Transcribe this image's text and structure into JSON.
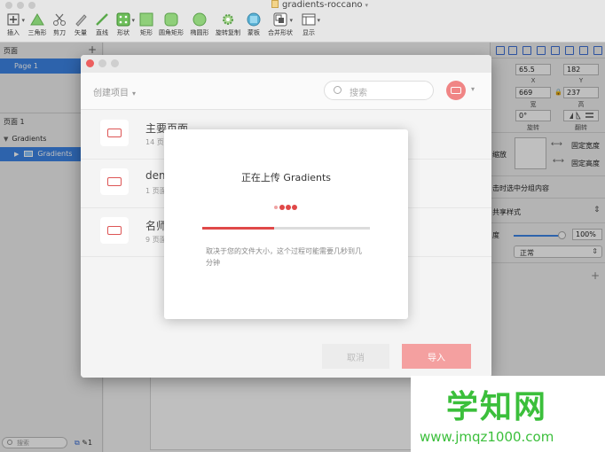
{
  "window": {
    "title": "gradients-roccano"
  },
  "toolbar": {
    "items": [
      {
        "label": "插入"
      },
      {
        "label": "三角形"
      },
      {
        "label": "剪刀"
      },
      {
        "label": "矢量"
      },
      {
        "label": "直线"
      },
      {
        "label": "形状"
      },
      {
        "label": "矩形"
      },
      {
        "label": "圆角矩形"
      },
      {
        "label": "椭圆形"
      },
      {
        "label": "旋转复制"
      },
      {
        "label": "蒙板"
      },
      {
        "label": "合并形状"
      },
      {
        "label": "显示"
      }
    ]
  },
  "pages_panel": {
    "header": "页面",
    "add": "+",
    "selected_page": "Page 1",
    "layers_header": "页面 1",
    "layer_group": "Gradients",
    "layer_child": "Gradients",
    "search_placeholder": "搜索",
    "footer_count": "1"
  },
  "inspector": {
    "x": "65.5",
    "x_caption": "X",
    "y": "182",
    "y_caption": "Y",
    "width": "669",
    "width_caption": "宽",
    "height": "237",
    "height_caption": "高",
    "rotation": "0°",
    "rotation_caption": "旋转",
    "flip_caption": "翻转",
    "resize_label": "缩放",
    "fix_width": "固定宽度",
    "fix_height": "固定高度",
    "group_text": "击时选中分组内容",
    "shared_style": "共享样式",
    "opacity_label": "度",
    "opacity_value": "100%",
    "blend_mode": "正常",
    "opacity_fraction": 0.92
  },
  "upload_window": {
    "project_selector": "创建项目",
    "search_placeholder": "搜索",
    "documents": [
      {
        "name": "主要页面",
        "pages": "14 页面"
      },
      {
        "name": "dem",
        "pages": "1 页面"
      },
      {
        "name": "名师",
        "pages": "9 页面"
      }
    ],
    "cancel": "取消",
    "import": "导入"
  },
  "modal": {
    "title": "正在上传 Gradients",
    "description": "取决于您的文件大小，这个过程可能需要几秒到几分钟",
    "progress": 0.43
  },
  "watermark": {
    "text": "学知网",
    "url": "www.jmqz1000.com"
  },
  "colors": {
    "accent": "#3c84e6",
    "brand_red": "#e04848",
    "watermark_green": "#3bbf3b"
  }
}
